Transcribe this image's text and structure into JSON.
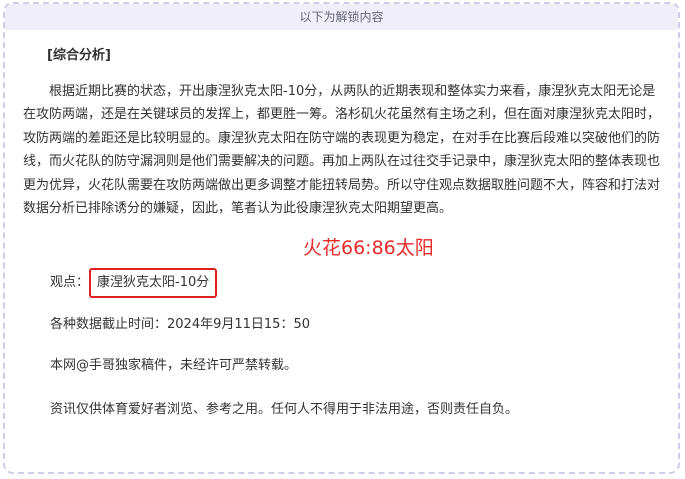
{
  "header": {
    "label": "以下为解锁内容"
  },
  "analysis": {
    "section_title": "[综合分析]",
    "body": "根据近期比赛的状态，开出康涅狄克太阳-10分，从两队的近期表现和整体实力来看，康涅狄克太阳无论是在攻防两端，还是在关键球员的发挥上，都更胜一筹。洛杉矶火花虽然有主场之利，但在面对康涅狄克太阳时，攻防两端的差距还是比较明显的。康涅狄克太阳在防守端的表现更为稳定，在对手在比赛后段难以突破他们的防线，而火花队的防守漏洞则是他们需要解决的问题。再加上两队在过往交手记录中，康涅狄克太阳的整体表现也更为优异，火花队需要在攻防两端做出更多调整才能扭转局势。所以守住观点数据取胜问题不大，阵容和打法对数据分析已排除诱分的嫌疑，因此，笔者认为此役康涅狄克太阳期望更高。"
  },
  "overlay": {
    "score_text": "火花66:86太阳",
    "color": "#e82a2a"
  },
  "view": {
    "label": "观点：",
    "value": "康涅狄克太阳-10分",
    "box_color": "#e02020"
  },
  "cutoff": {
    "text": "各种数据截止时间：2024年9月11日15：50"
  },
  "copyright": {
    "text": "本网@手哥独家稿件，未经许可严禁转载。"
  },
  "disclaimer": {
    "text": "资讯仅供体育爱好者浏览、参考之用。任何人不得用于非法用途，否则责任自负。"
  },
  "colors": {
    "header_bg": "#f0eff9",
    "border": "#cfcdea",
    "text": "#333333"
  }
}
